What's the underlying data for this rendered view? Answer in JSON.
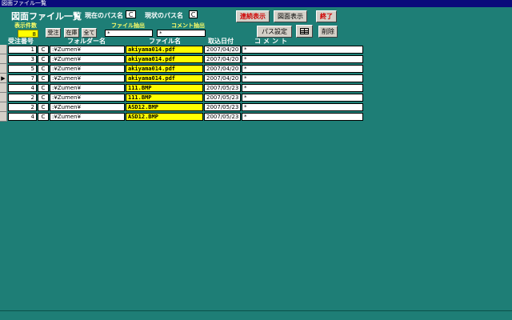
{
  "window": {
    "title": "図面ファイル一覧"
  },
  "header": {
    "title": "図面ファイル一覧",
    "current_path_label": "現在のパス名",
    "current_path_value": "C",
    "prev_path_label": "現状のパス名",
    "prev_path_value": "C"
  },
  "buttons": {
    "continuous_view": "連続表示",
    "drawing_view": "図面表示",
    "exit": "終了",
    "path_settings": "パス設定",
    "delete": "削除",
    "order": "受注",
    "stock": "在庫",
    "all": "全て"
  },
  "filters": {
    "count_label": "表示件数",
    "count_value": "8",
    "file_filter_label": "ファイル抽出",
    "file_filter_value": "*",
    "comment_filter_label": "コメント抽出",
    "comment_filter_value": "*"
  },
  "columns": {
    "order_no": "受注番号",
    "folder": "フォルダー名",
    "file": "ファイル名",
    "date": "取込日付",
    "comment": "コメント"
  },
  "rows": [
    {
      "num": "1",
      "drive": "C",
      "folder": ":¥Zumen¥",
      "file": "akiyama014.pdf",
      "date": "2007/04/20",
      "comment": "*",
      "marker": ""
    },
    {
      "num": "3",
      "drive": "C",
      "folder": ":¥Zumen¥",
      "file": "akiyama014.pdf",
      "date": "2007/04/20",
      "comment": "*",
      "marker": ""
    },
    {
      "num": "5",
      "drive": "C",
      "folder": ":¥Zumen¥",
      "file": "akiyama014.pdf",
      "date": "2007/04/20",
      "comment": "*",
      "marker": ""
    },
    {
      "num": "7",
      "drive": "C",
      "folder": ":¥Zumen¥",
      "file": "akiyama014.pdf",
      "date": "2007/04/20",
      "comment": "*",
      "marker": "▶"
    },
    {
      "num": "4",
      "drive": "C",
      "folder": ":¥Zumen¥",
      "file": "111.BMP",
      "date": "2007/05/23",
      "comment": "*",
      "marker": ""
    },
    {
      "num": "2",
      "drive": "C",
      "folder": ":¥Zumen¥",
      "file": "111.BMP",
      "date": "2007/05/23",
      "comment": "*",
      "marker": ""
    },
    {
      "num": "2",
      "drive": "C",
      "folder": ":¥Zumen¥",
      "file": "ASD12.BMP",
      "date": "2007/05/23",
      "comment": "*",
      "marker": ""
    },
    {
      "num": "4",
      "drive": "C",
      "folder": ":¥Zumen¥",
      "file": "ASD12.BMP",
      "date": "2007/05/23",
      "comment": "*",
      "marker": ""
    }
  ]
}
